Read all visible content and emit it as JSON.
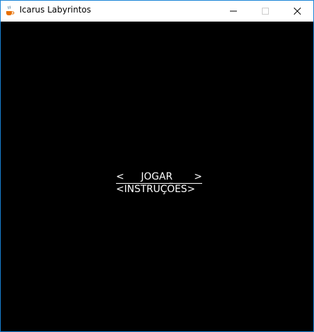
{
  "window": {
    "title": "Icarus Labyrintos",
    "icon": "java-coffee-icon",
    "controls": {
      "minimize": "minimize-icon",
      "maximize": "maximize-icon",
      "close": "close-icon"
    },
    "accent": "#1883d7"
  },
  "menu": {
    "background": "#000000",
    "text_color": "#ffffff",
    "items": [
      {
        "left_bracket": "<",
        "label": "JOGAR",
        "right_bracket": ">",
        "selected": true
      },
      {
        "full_text": "<INSTRUÇÕES>",
        "selected": false
      }
    ]
  }
}
